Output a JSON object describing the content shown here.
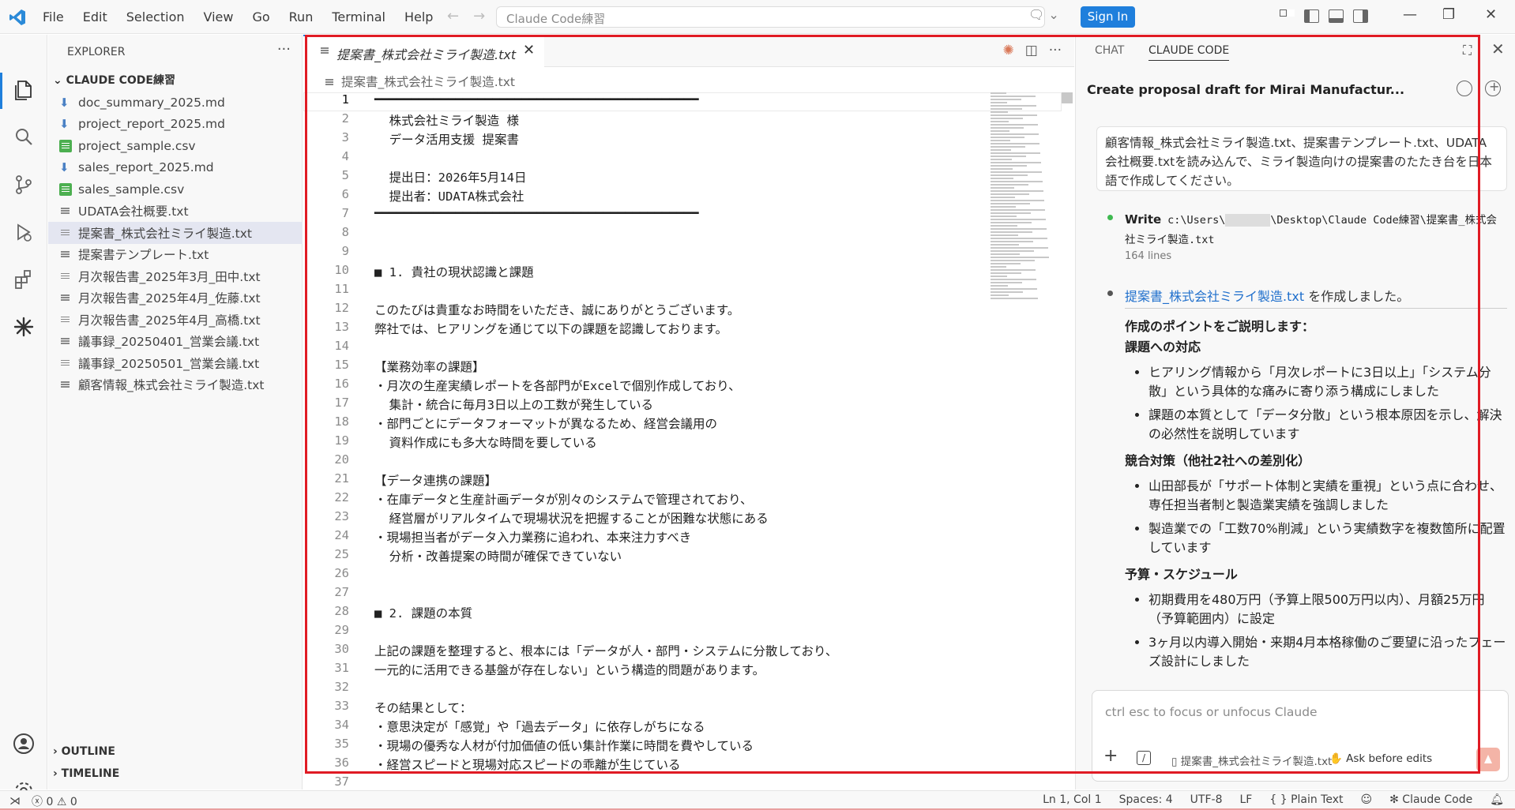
{
  "titlebar": {
    "menu": [
      "File",
      "Edit",
      "Selection",
      "View",
      "Go",
      "Run",
      "Terminal",
      "Help"
    ],
    "search_text": "Claude Code練習",
    "sign_in_label": "Sign In"
  },
  "explorer": {
    "title": "EXPLORER",
    "folder": "CLAUDE CODE練習",
    "files": [
      {
        "name": "doc_summary_2025.md",
        "type": "md"
      },
      {
        "name": "project_report_2025.md",
        "type": "md"
      },
      {
        "name": "project_sample.csv",
        "type": "csv"
      },
      {
        "name": "sales_report_2025.md",
        "type": "md"
      },
      {
        "name": "sales_sample.csv",
        "type": "csv"
      },
      {
        "name": "UDATA会社概要.txt",
        "type": "txt"
      },
      {
        "name": "提案書_株式会社ミライ製造.txt",
        "type": "txt",
        "selected": true
      },
      {
        "name": "提案書テンプレート.txt",
        "type": "txt"
      },
      {
        "name": "月次報告書_2025年3月_田中.txt",
        "type": "txt"
      },
      {
        "name": "月次報告書_2025年4月_佐藤.txt",
        "type": "txt"
      },
      {
        "name": "月次報告書_2025年4月_高橋.txt",
        "type": "txt"
      },
      {
        "name": "議事録_20250401_営業会議.txt",
        "type": "txt"
      },
      {
        "name": "議事録_20250501_営業会議.txt",
        "type": "txt"
      },
      {
        "name": "顧客情報_株式会社ミライ製造.txt",
        "type": "txt"
      }
    ],
    "outline_label": "OUTLINE",
    "timeline_label": "TIMELINE"
  },
  "editor": {
    "tab_title": "提案書_株式会社ミライ製造.txt",
    "breadcrumb": "提案書_株式会社ミライ製造.txt",
    "lines": [
      {
        "n": "1",
        "t": "━━━━━━━━━━━━━━━━━━━━━━━━━━━━━━━━━━━━━━━━━━━━"
      },
      {
        "n": "2",
        "t": "  株式会社ミライ製造 様"
      },
      {
        "n": "3",
        "t": "  データ活用支援 提案書"
      },
      {
        "n": "4",
        "t": ""
      },
      {
        "n": "5",
        "t": "  提出日：2026年5月14日"
      },
      {
        "n": "6",
        "t": "  提出者：UDATA株式会社"
      },
      {
        "n": "7",
        "t": "━━━━━━━━━━━━━━━━━━━━━━━━━━━━━━━━━━━━━━━━━━━━"
      },
      {
        "n": "8",
        "t": ""
      },
      {
        "n": "9",
        "t": ""
      },
      {
        "n": "10",
        "t": "■ 1. 貴社の現状認識と課題"
      },
      {
        "n": "11",
        "t": ""
      },
      {
        "n": "12",
        "t": "このたびは貴重なお時間をいただき、誠にありがとうございます。"
      },
      {
        "n": "13",
        "t": "弊社では、ヒアリングを通じて以下の課題を認識しております。"
      },
      {
        "n": "14",
        "t": ""
      },
      {
        "n": "15",
        "t": "【業務効率の課題】"
      },
      {
        "n": "16",
        "t": "・月次の生産実績レポートを各部門がExcelで個別作成しており、"
      },
      {
        "n": "17",
        "t": "  集計・統合に毎月3日以上の工数が発生している"
      },
      {
        "n": "18",
        "t": "・部門ごとにデータフォーマットが異なるため、経営会議用の"
      },
      {
        "n": "19",
        "t": "  資料作成にも多大な時間を要している"
      },
      {
        "n": "20",
        "t": ""
      },
      {
        "n": "21",
        "t": "【データ連携の課題】"
      },
      {
        "n": "22",
        "t": "・在庫データと生産計画データが別々のシステムで管理されており、"
      },
      {
        "n": "23",
        "t": "  経営層がリアルタイムで現場状況を把握することが困難な状態にある"
      },
      {
        "n": "24",
        "t": "・現場担当者がデータ入力業務に追われ、本来注力すべき"
      },
      {
        "n": "25",
        "t": "  分析・改善提案の時間が確保できていない"
      },
      {
        "n": "26",
        "t": ""
      },
      {
        "n": "27",
        "t": ""
      },
      {
        "n": "28",
        "t": "■ 2. 課題の本質"
      },
      {
        "n": "29",
        "t": ""
      },
      {
        "n": "30",
        "t": "上記の課題を整理すると、根本には「データが人・部門・システムに分散しており、"
      },
      {
        "n": "31",
        "t": "一元的に活用できる基盤が存在しない」という構造的問題があります。"
      },
      {
        "n": "32",
        "t": ""
      },
      {
        "n": "33",
        "t": "その結果として："
      },
      {
        "n": "34",
        "t": "・意思決定が「感覚」や「過去データ」に依存しがちになる"
      },
      {
        "n": "35",
        "t": "・現場の優秀な人材が付加価値の低い集計作業に時間を費やしている"
      },
      {
        "n": "36",
        "t": "・経営スピードと現場対応スピードの乖離が生じている"
      },
      {
        "n": "37",
        "t": ""
      }
    ]
  },
  "panel": {
    "tab_chat": "CHAT",
    "tab_claude": "CLAUDE CODE",
    "session_title": "Create proposal draft for Mirai Manufactur...",
    "user_message": "顧客情報_株式会社ミライ製造.txt、提案書テンプレート.txt、UDATA会社概要.txtを読み込んで、ミライ製造向けの提案書のたたき台を日本語で作成してください。",
    "write_label": "Write",
    "write_path_1": "c:\\Users\\",
    "write_path_2": "\\Desktop\\Claude Code練習\\提案書_株式会社ミライ製造.txt",
    "write_lines": "164 lines",
    "created_link": "提案書_株式会社ミライ製造.txt",
    "created_suffix": " を作成しました。",
    "intro": "作成のポイントをご説明します：",
    "sections": [
      {
        "heading": "課題への対応",
        "items": [
          "ヒアリング情報から「月次レポートに3日以上」「システム分散」という具体的な痛みに寄り添う構成にしました",
          "課題の本質として「データ分散」という根本原因を示し、解決の必然性を説明しています"
        ]
      },
      {
        "heading": "競合対策（他社2社への差別化）",
        "items": [
          "山田部長が「サポート体制と実績を重視」という点に合わせ、専任担当者制と製造業実績を強調しました",
          "製造業での「工数70%削減」という実績数字を複数箇所に配置しています"
        ]
      },
      {
        "heading": "予算・スケジュール",
        "items": [
          "初期費用を480万円（予算上限500万円以内）、月額25万円（予算範囲内）に設定",
          "3ヶ月以内導入開始・来期4月本格稼働のご要望に沿ったフェーズ設計にしました"
        ]
      }
    ],
    "input_placeholder": "ctrl esc to focus or unfocus Claude",
    "input_file": "提案書_株式会社ミライ製造.txt",
    "ask_mode": "Ask before edits"
  },
  "statusbar": {
    "errors": "0",
    "warnings": "0",
    "position": "Ln 1, Col 1",
    "spaces": "Spaces: 4",
    "encoding": "UTF-8",
    "eol": "LF",
    "language": "Plain Text",
    "claude": "✻ Claude Code"
  }
}
